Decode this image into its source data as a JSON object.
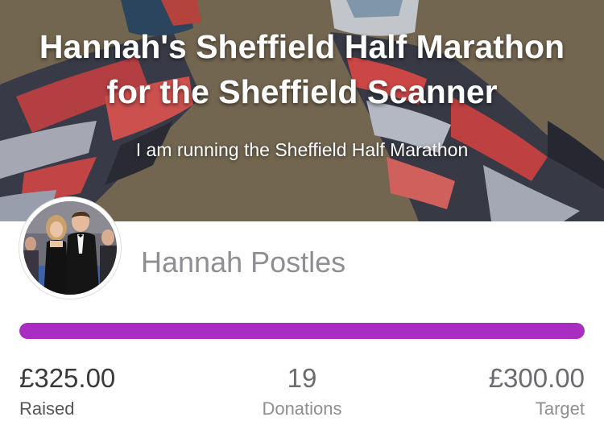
{
  "hero": {
    "title": "Hannah's Sheffield Half Marathon for the Sheffield Scanner",
    "subtitle": "I am running the Sheffield Half Marathon"
  },
  "fundraiser": {
    "name": "Hannah Postles"
  },
  "progress": {
    "fraction_filled": 1.0,
    "color": "#a72ec0"
  },
  "stats": {
    "raised": {
      "value": "£325.00",
      "label": "Raised"
    },
    "donations": {
      "value": "19",
      "label": "Donations"
    },
    "target": {
      "value": "£300.00",
      "label": "Target"
    }
  }
}
